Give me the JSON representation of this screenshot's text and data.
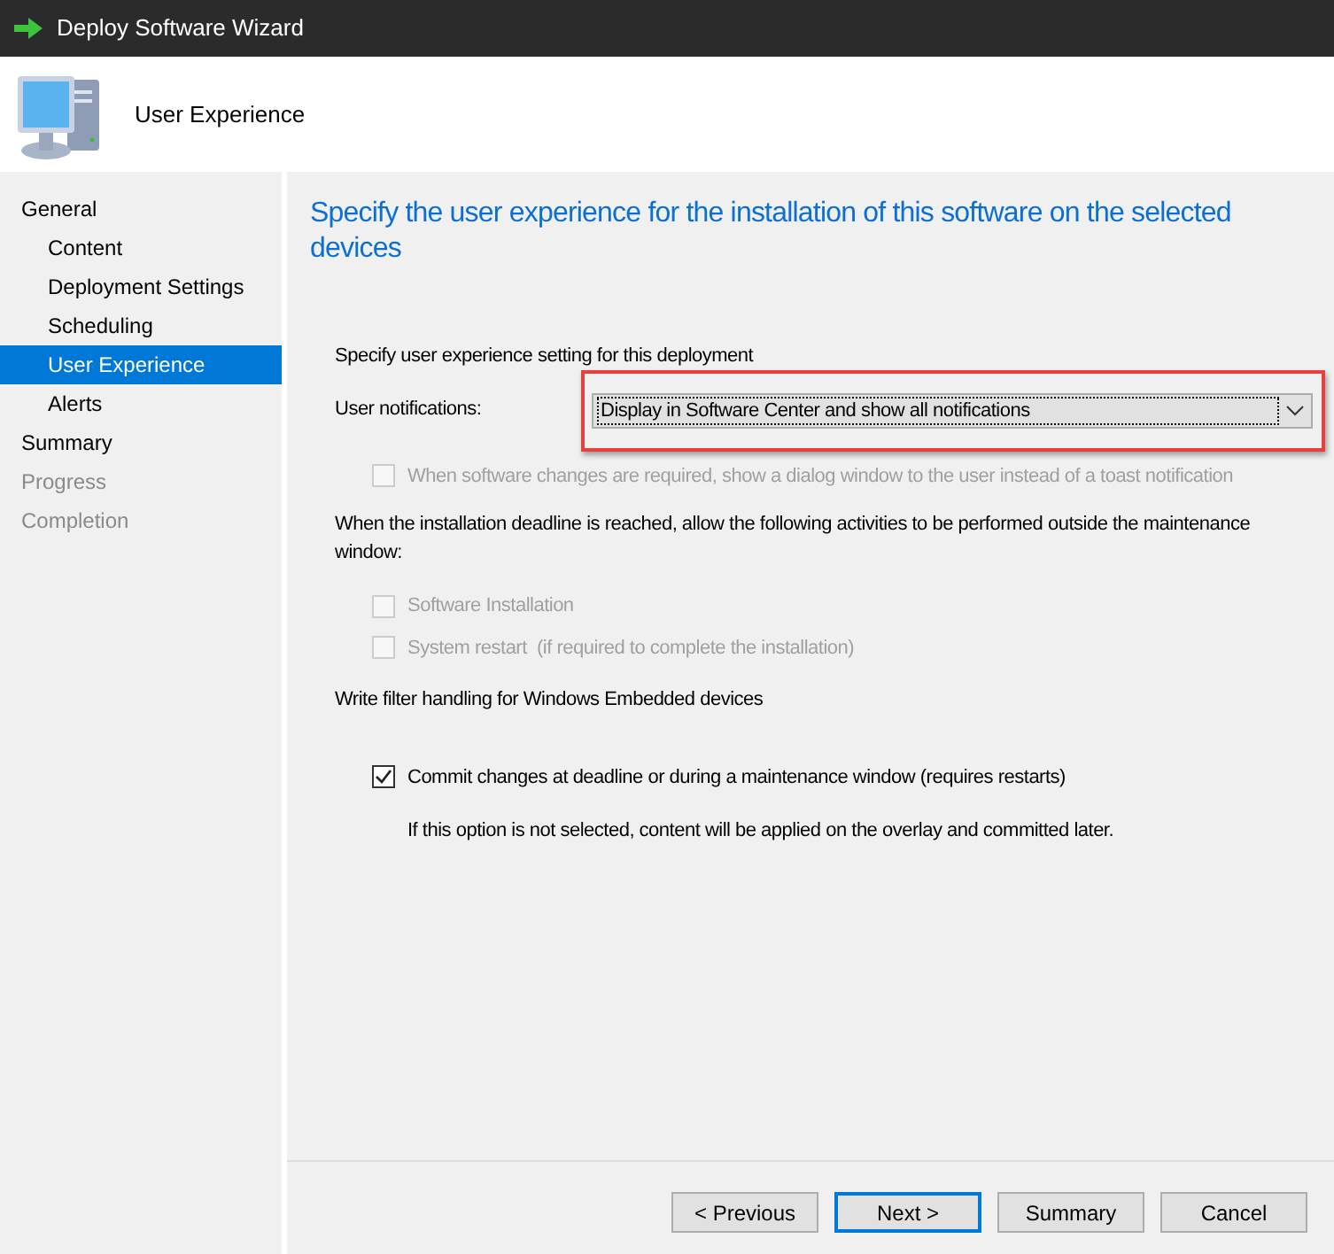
{
  "window": {
    "title": "Deploy Software Wizard"
  },
  "header": {
    "title": "User Experience"
  },
  "sidebar": {
    "items": [
      {
        "label": "General",
        "selected": false,
        "disabled": false,
        "children": [
          {
            "label": "Content",
            "selected": false,
            "disabled": false
          },
          {
            "label": "Deployment Settings",
            "selected": false,
            "disabled": false
          },
          {
            "label": "Scheduling",
            "selected": false,
            "disabled": false
          },
          {
            "label": "User Experience",
            "selected": true,
            "disabled": false
          },
          {
            "label": "Alerts",
            "selected": false,
            "disabled": false
          }
        ]
      },
      {
        "label": "Summary",
        "selected": false,
        "disabled": false
      },
      {
        "label": "Progress",
        "selected": false,
        "disabled": true
      },
      {
        "label": "Completion",
        "selected": false,
        "disabled": true
      }
    ]
  },
  "page": {
    "heading": "Specify the user experience for the installation of this software on the selected devices",
    "setting_label": "Specify user experience setting for this deployment",
    "notifications": {
      "label": "User notifications:",
      "value": "Display in Software Center and show all notifications",
      "highlighted": true
    },
    "dialog_option": {
      "label": "When software changes are required, show a dialog window to the user instead of a toast notification",
      "checked": false,
      "disabled": true
    },
    "deadline_label": "When the installation deadline is reached, allow the following activities to be performed outside the maintenance window:",
    "deadline_options": [
      {
        "label": "Software Installation",
        "checked": false,
        "disabled": true
      },
      {
        "label": "System restart  (if required to complete the installation)",
        "checked": false,
        "disabled": true
      }
    ],
    "write_filter_label": "Write filter handling for Windows Embedded devices",
    "commit_option": {
      "label": "Commit changes at deadline or during a maintenance window (requires restarts)",
      "checked": true,
      "disabled": false
    },
    "commit_note": "If this option is not selected, content will be applied on the overlay and committed later."
  },
  "buttons": [
    {
      "label": "< Previous",
      "default": false
    },
    {
      "label": "Next >",
      "default": true
    },
    {
      "label": "Summary",
      "default": false
    },
    {
      "label": "Cancel",
      "default": false
    }
  ]
}
